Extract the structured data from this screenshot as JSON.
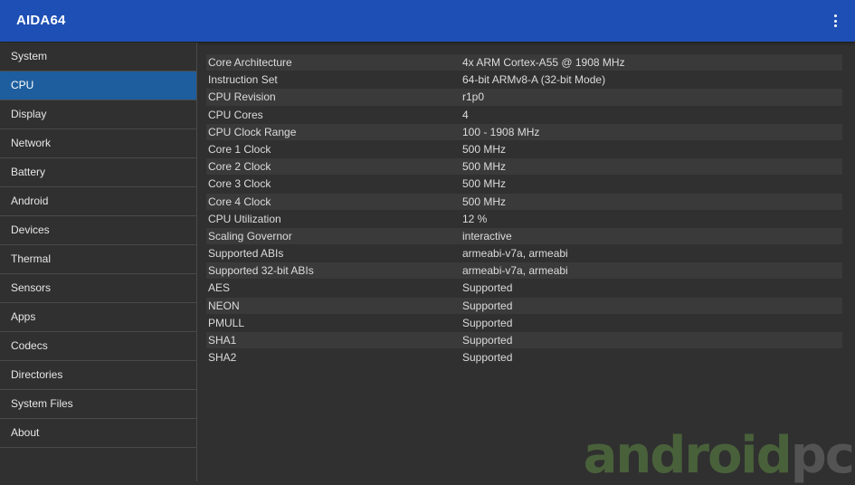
{
  "app": {
    "title": "AIDA64",
    "menu_icon": "more-vertical-icon",
    "accent_color": "#1e4fb4",
    "selected_color": "#1e5e9e"
  },
  "sidebar": {
    "items": [
      {
        "label": "System"
      },
      {
        "label": "CPU",
        "selected": true
      },
      {
        "label": "Display"
      },
      {
        "label": "Network"
      },
      {
        "label": "Battery"
      },
      {
        "label": "Android"
      },
      {
        "label": "Devices"
      },
      {
        "label": "Thermal"
      },
      {
        "label": "Sensors"
      },
      {
        "label": "Apps"
      },
      {
        "label": "Codecs"
      },
      {
        "label": "Directories"
      },
      {
        "label": "System Files"
      },
      {
        "label": "About"
      }
    ]
  },
  "details": {
    "rows": [
      {
        "key": "Core Architecture",
        "value": "4x ARM Cortex-A55 @ 1908 MHz"
      },
      {
        "key": "Instruction Set",
        "value": "64-bit ARMv8-A (32-bit Mode)"
      },
      {
        "key": "CPU Revision",
        "value": "r1p0"
      },
      {
        "key": "CPU Cores",
        "value": "4"
      },
      {
        "key": "CPU Clock Range",
        "value": "100 - 1908 MHz"
      },
      {
        "key": "Core 1 Clock",
        "value": "500 MHz"
      },
      {
        "key": "Core 2 Clock",
        "value": "500 MHz"
      },
      {
        "key": "Core 3 Clock",
        "value": "500 MHz"
      },
      {
        "key": "Core 4 Clock",
        "value": "500 MHz"
      },
      {
        "key": "CPU Utilization",
        "value": "12 %"
      },
      {
        "key": "Scaling Governor",
        "value": "interactive"
      },
      {
        "key": "Supported ABIs",
        "value": "armeabi-v7a, armeabi"
      },
      {
        "key": "Supported 32-bit ABIs",
        "value": "armeabi-v7a, armeabi"
      },
      {
        "key": "AES",
        "value": "Supported"
      },
      {
        "key": "NEON",
        "value": "Supported"
      },
      {
        "key": "PMULL",
        "value": "Supported"
      },
      {
        "key": "SHA1",
        "value": "Supported"
      },
      {
        "key": "SHA2",
        "value": "Supported"
      }
    ]
  },
  "watermark": {
    "text_main": "android",
    "text_suffix": "pc"
  }
}
